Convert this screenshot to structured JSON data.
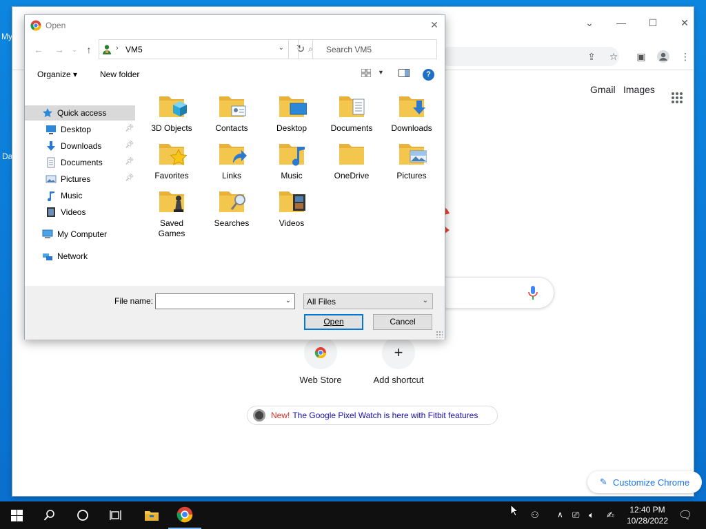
{
  "desktop": {
    "label1": "My",
    "label2": "Da"
  },
  "browser": {
    "header_links": [
      "Gmail",
      "Images"
    ],
    "shortcuts": [
      {
        "label": "Web Store"
      },
      {
        "label": "Add shortcut",
        "icon": "+"
      }
    ],
    "promo": {
      "new": "New!",
      "text": "The Google Pixel Watch is here with Fitbit features"
    },
    "customize": "Customize Chrome"
  },
  "dialog": {
    "title": "Open",
    "address": "VM5",
    "search_placeholder": "Search VM5",
    "toolbar": {
      "organize": "Organize",
      "new_folder": "New folder"
    },
    "nav": [
      {
        "label": "Quick access",
        "icon": "star-icon",
        "pinned": false,
        "selected": true
      },
      {
        "label": "Desktop",
        "icon": "desktop-icon",
        "pinned": true
      },
      {
        "label": "Downloads",
        "icon": "download-icon",
        "pinned": true
      },
      {
        "label": "Documents",
        "icon": "document-icon",
        "pinned": true
      },
      {
        "label": "Pictures",
        "icon": "pictures-icon",
        "pinned": true
      },
      {
        "label": "Music",
        "icon": "music-icon",
        "pinned": false
      },
      {
        "label": "Videos",
        "icon": "videos-icon",
        "pinned": false
      },
      {
        "label": "My Computer",
        "icon": "computer-icon",
        "pinned": false
      },
      {
        "label": "Network",
        "icon": "network-icon",
        "pinned": false
      }
    ],
    "files": [
      {
        "label": "3D Objects",
        "overlay": "cube"
      },
      {
        "label": "Contacts",
        "overlay": "contact"
      },
      {
        "label": "Desktop",
        "overlay": "monitor"
      },
      {
        "label": "Documents",
        "overlay": "doc"
      },
      {
        "label": "Downloads",
        "overlay": "arrow"
      },
      {
        "label": "Favorites",
        "overlay": "star"
      },
      {
        "label": "Links",
        "overlay": "link"
      },
      {
        "label": "Music",
        "overlay": "note"
      },
      {
        "label": "OneDrive",
        "overlay": "none"
      },
      {
        "label": "Pictures",
        "overlay": "photo"
      },
      {
        "label": "Saved Games",
        "overlay": "chess"
      },
      {
        "label": "Searches",
        "overlay": "magnifier"
      },
      {
        "label": "Videos",
        "overlay": "film"
      }
    ],
    "file_name_label": "File name:",
    "file_name_value": "",
    "filter": "All Files",
    "open_button": "Open",
    "cancel_button": "Cancel"
  },
  "taskbar": {
    "time": "12:40 PM",
    "date": "10/28/2022"
  },
  "colors": {
    "folder": "#f3c64d",
    "accent": "#0078d7",
    "desktop": "#0a78d4",
    "taskbar": "#101010"
  }
}
